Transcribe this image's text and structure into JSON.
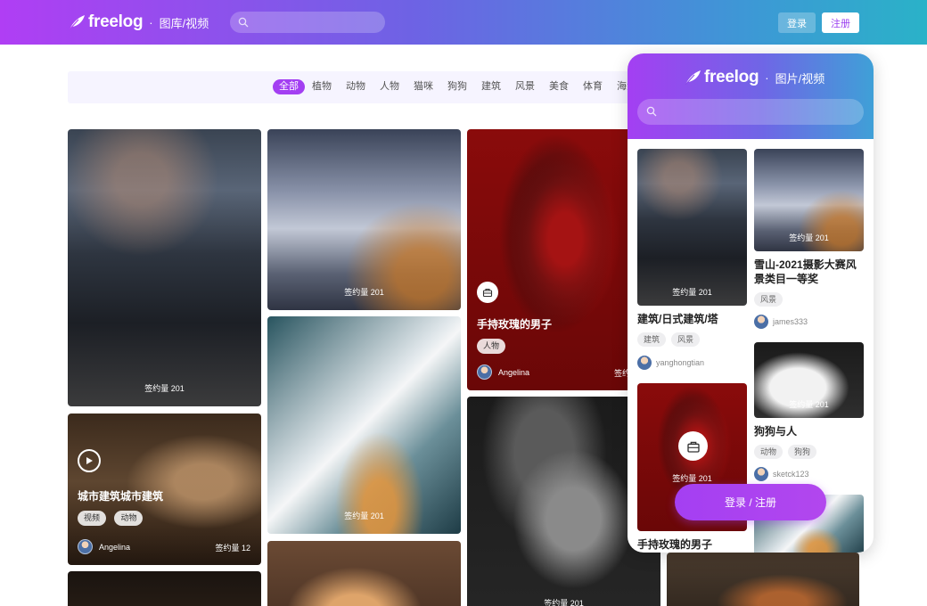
{
  "header": {
    "brand": "freelog",
    "separator": "·",
    "section": "图库/视频",
    "search_placeholder": "",
    "login_label": "登录",
    "register_label": "注册"
  },
  "categories": [
    "全部",
    "植物",
    "动物",
    "人物",
    "猫咪",
    "狗狗",
    "建筑",
    "风景",
    "美食",
    "体育",
    "海洋世界"
  ],
  "active_category": "全部",
  "cards": {
    "pagoda": {
      "count": "签约量 201"
    },
    "mountain": {
      "count": "签约量 201"
    },
    "rose": {
      "title": "手持玫瑰的男子",
      "tag": "人物",
      "user": "Angelina",
      "count": "签约"
    },
    "building": {
      "count": "签约量 201"
    },
    "squirrel": {
      "title": "城市建筑城市建筑",
      "tags": [
        "视频",
        "动物"
      ],
      "user": "Angelina",
      "count": "签约量 12"
    },
    "dog": {
      "count": "签约量 201"
    }
  },
  "mobile": {
    "brand": "freelog",
    "separator": "·",
    "section": "图片/视频",
    "search_placeholder": "",
    "items": [
      {
        "count": "签约量 201",
        "title": "建筑/日式建筑/塔",
        "tags": [
          "建筑",
          "风景"
        ],
        "user": "yanghongtian"
      },
      {
        "count": "签约量 201",
        "title": "雪山-2021摄影大赛风景类目一等奖",
        "tags": [
          "风景"
        ],
        "user": "james333"
      },
      {
        "count": "签约量 201",
        "title": "手持玫瑰的男子"
      },
      {
        "count": "签约量 201",
        "title": "狗狗与人",
        "tags": [
          "动物",
          "狗狗"
        ],
        "user": "sketck123"
      }
    ],
    "cta_label": "登录 / 注册"
  },
  "colors": {
    "accent": "#a33ff2",
    "header_start": "#b03ef4",
    "header_end": "#2ab2c8"
  }
}
